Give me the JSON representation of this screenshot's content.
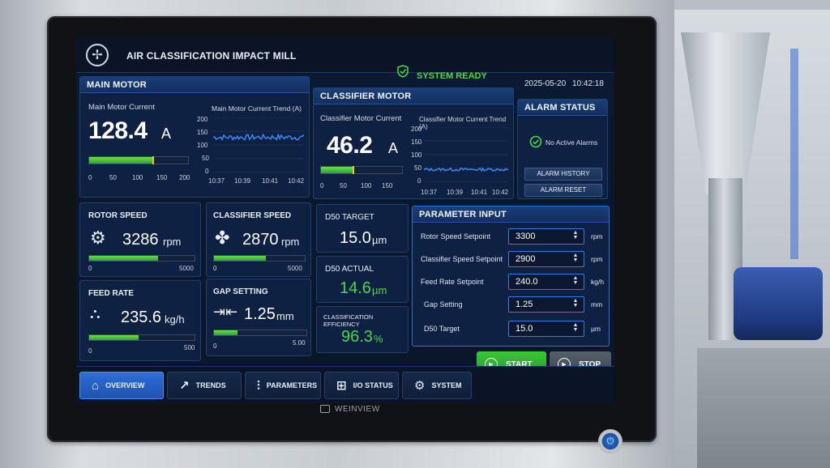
{
  "header": {
    "title": "AIR CLASSIFICATION IMPACT MILL",
    "status": "SYSTEM READY",
    "date": "2025-05-20",
    "time": "10:42:18"
  },
  "main_motor": {
    "title": "MAIN MOTOR",
    "current_label": "Main Motor Current",
    "current_value": "128.4",
    "current_unit": "A",
    "bar_fraction": 0.642,
    "scale": [
      "0",
      "50",
      "100",
      "150",
      "200"
    ],
    "trend_title": "Main Motor Current Trend (A)",
    "trend_y": [
      "200",
      "150",
      "100",
      "50",
      "0"
    ],
    "trend_x": [
      "10:37",
      "10:39",
      "10:41",
      "10:42"
    ]
  },
  "classifier_motor": {
    "title": "CLASSIFIER MOTOR",
    "current_label": "Classifier Motor Current",
    "current_value": "46.2",
    "current_unit": "A",
    "bar_fraction": 0.385,
    "scale": [
      "0",
      "50",
      "100",
      "150"
    ],
    "trend_title": "Classifier Motor Current Trend (A)",
    "trend_y": [
      "200",
      "150",
      "100",
      "50",
      "0"
    ],
    "trend_x": [
      "10:37",
      "10:39",
      "10:41",
      "10:42"
    ]
  },
  "alarm": {
    "title": "ALARM STATUS",
    "status": "No Active Alarms",
    "history_label": "ALARM HISTORY",
    "reset_label": "ALARM RESET"
  },
  "tiles": {
    "rotor": {
      "title": "ROTOR SPEED",
      "value": "3286",
      "unit": "rpm",
      "min": "0",
      "max": "5000",
      "fraction": 0.657
    },
    "classifier": {
      "title": "CLASSIFIER SPEED",
      "value": "2870",
      "unit": "rpm",
      "min": "0",
      "max": "5000",
      "fraction": 0.574
    },
    "feed": {
      "title": "FEED RATE",
      "value": "235.6",
      "unit": "kg/h",
      "min": "0",
      "max": "500",
      "fraction": 0.471
    },
    "gap": {
      "title": "GAP SETTING",
      "value": "1.25",
      "unit": "mm",
      "min": "0",
      "max": "5.00",
      "fraction": 0.25
    }
  },
  "d50": {
    "target_label": "D50 TARGET",
    "target_value": "15.0",
    "target_unit": "µm",
    "actual_label": "D50 ACTUAL",
    "actual_value": "14.6",
    "actual_unit": "µm",
    "eff_label": "CLASSIFICATION EFFICIENCY",
    "eff_value": "96.3",
    "eff_unit": "%"
  },
  "params": {
    "title": "PARAMETER INPUT",
    "rows": [
      {
        "label": "Rotor Speed Setpoint",
        "value": "3300",
        "unit": "rpm"
      },
      {
        "label": "Classifier Speed Setpoint",
        "value": "2900",
        "unit": "rpm"
      },
      {
        "label": "Feed Rate Setpoint",
        "value": "240.0",
        "unit": "kg/h"
      },
      {
        "label": "Gap Setting",
        "value": "1.25",
        "unit": "mm"
      },
      {
        "label": "D50 Target",
        "value": "15.0",
        "unit": "µm"
      }
    ]
  },
  "controls": {
    "start": "START",
    "stop": "STOP"
  },
  "nav": {
    "overview": "OVERVIEW",
    "trends": "TRENDS",
    "parameters": "PARAMETERS",
    "io_status": "I/O STATUS",
    "system": "SYSTEM"
  },
  "brand": "WEINVIEW",
  "colors": {
    "accent": "#2e6fd8",
    "ok": "#48d64e",
    "bar": "#3fc23a",
    "trend": "#3e8cff"
  },
  "icons": {
    "logo": "fan-icon",
    "status": "shield-check-icon",
    "alarm_ok": "check-circle-icon",
    "rotor": "rotor-icon",
    "classifier": "fan-icon",
    "feed": "conveyor-icon",
    "gap": "gap-arrows-icon"
  }
}
